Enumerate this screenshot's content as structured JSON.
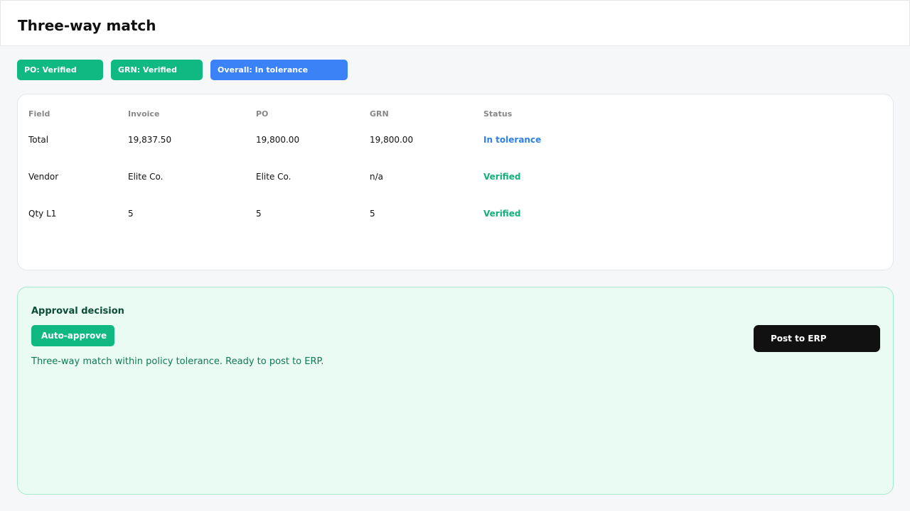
{
  "header": {
    "title": "Three-way match"
  },
  "badges": [
    {
      "label": "PO: Verified"
    },
    {
      "label": "GRN: Verified"
    },
    {
      "label": "Overall: In tolerance"
    }
  ],
  "table": {
    "headers": [
      "Field",
      "Invoice",
      "PO",
      "GRN",
      "Status"
    ],
    "rows": [
      [
        "Total",
        "19,837.50",
        "19,800.00",
        "19,800.00",
        "In tolerance"
      ],
      [
        "Vendor",
        "Elite Co.",
        "Elite Co.",
        "n/a",
        "Verified"
      ],
      [
        "Qty L1",
        "5",
        "5",
        "5",
        "Verified"
      ]
    ]
  },
  "approval": {
    "title": "Approval decision",
    "decision_label": "Auto-approve",
    "message": "Three-way match within policy tolerance. Ready to post to ERP.",
    "post_button": "Post to ERP"
  },
  "colors": {
    "verified": "#10b981",
    "tolerance": "#3b82f6",
    "primary_button": "#111111"
  }
}
